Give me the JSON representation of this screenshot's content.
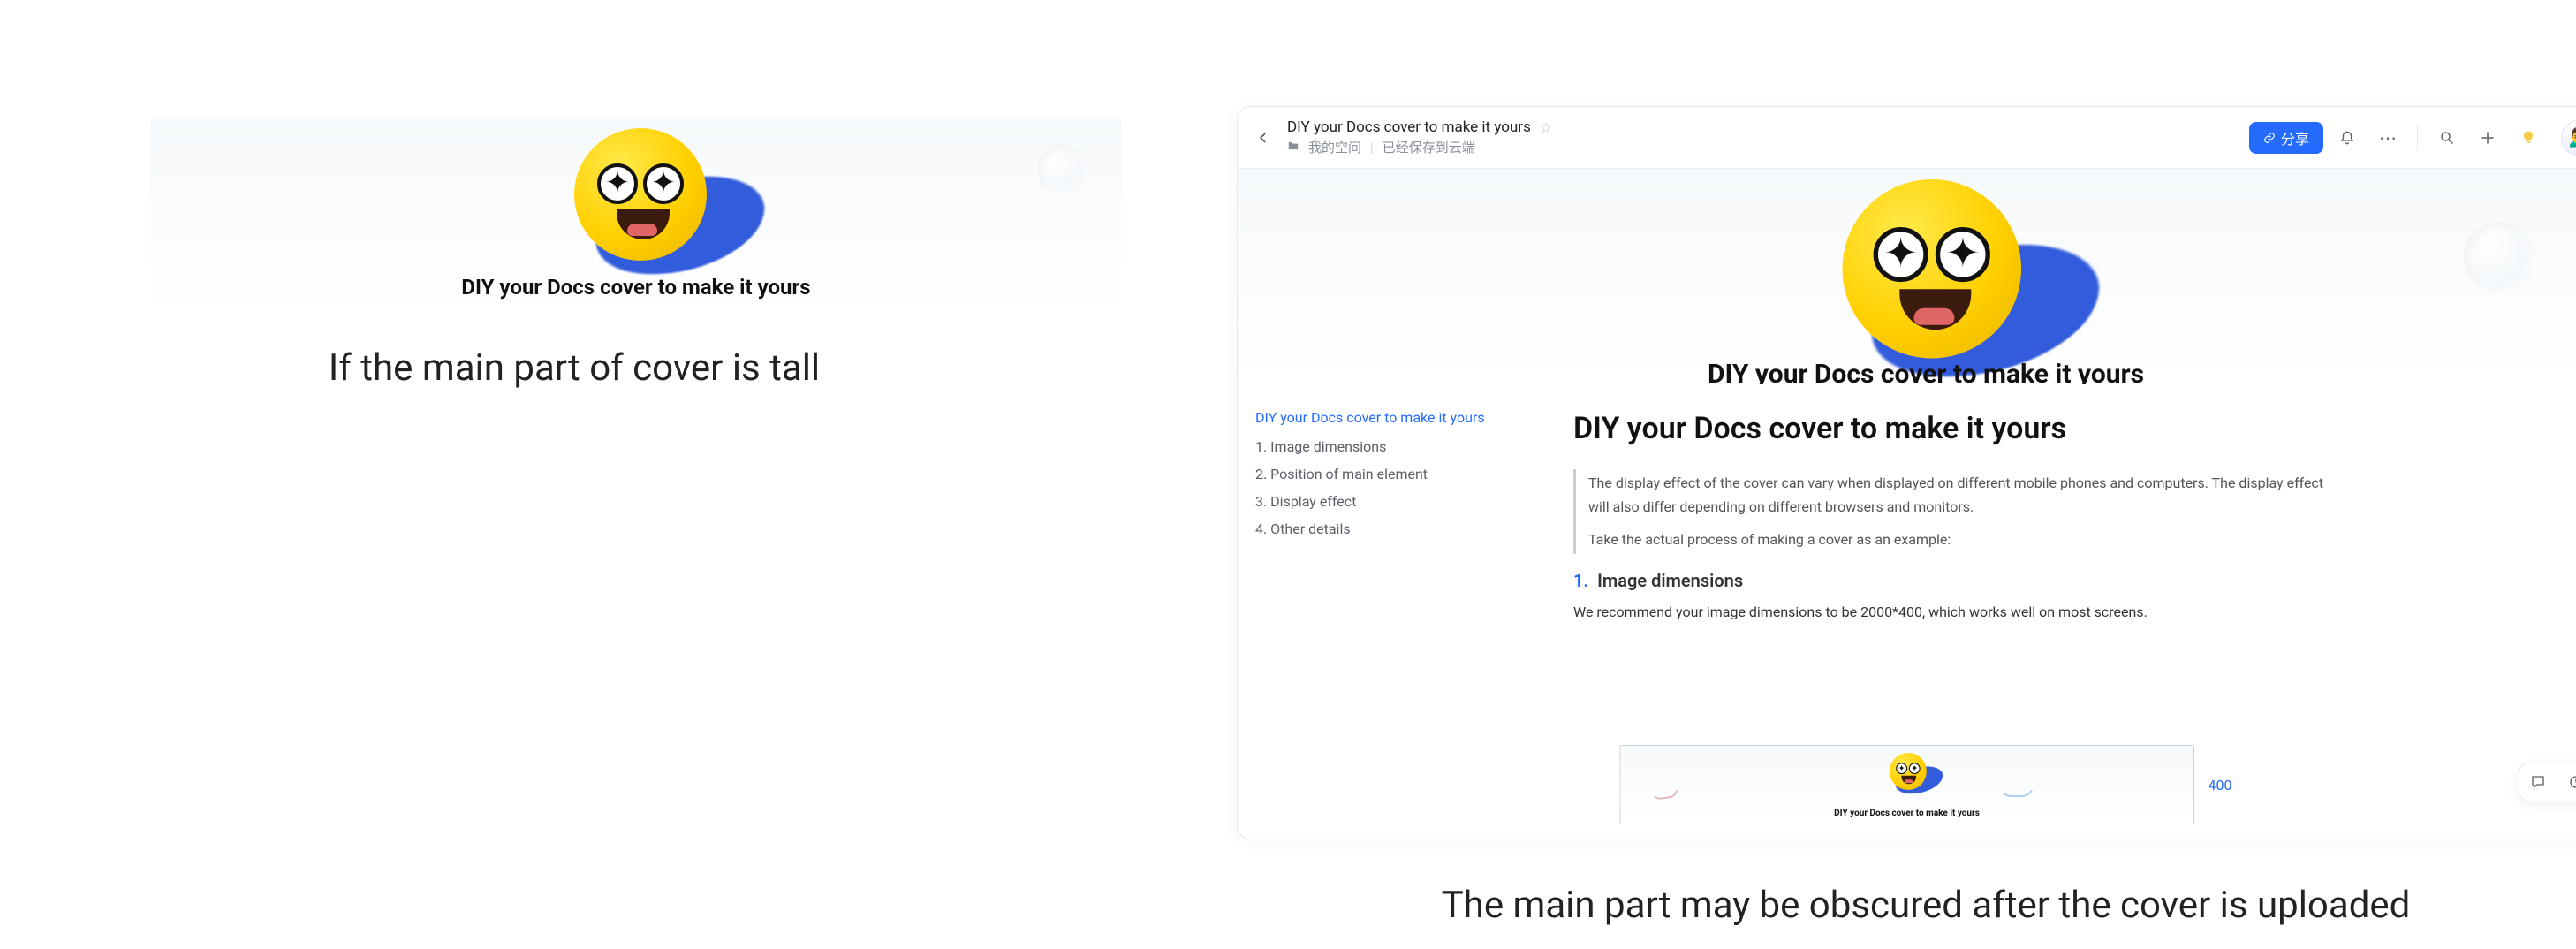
{
  "left": {
    "cover_title": "DIY your Docs cover to make it yours",
    "caption": "If the main part of cover is tall"
  },
  "right": {
    "caption": "The main part may be obscured after the cover is uploaded",
    "header": {
      "doc_title": "DIY your Docs cover to make it yours",
      "breadcrumb_space": "我的空间",
      "save_status": "已经保存到云端",
      "share_label": "分享"
    },
    "cover_title_cut": "DIY your Docs cover to make it yours",
    "outline": {
      "title": "DIY your Docs cover to make it yours",
      "items": [
        "1. Image dimensions",
        "2. Position of main element",
        "3. Display effect",
        "4. Other details"
      ]
    },
    "doc": {
      "h1": "DIY your Docs cover to make it yours",
      "quote_line1": "The display effect of the cover can vary when displayed on different mobile phones and computers. The display effect will also differ depending on different browsers and monitors.",
      "quote_line2": "Take the actual process of making a cover as an example:",
      "sec1_num": "1.",
      "sec1_title": "Image dimensions",
      "sec1_body": "We recommend your image dimensions to be 2000*400, which works well on most screens.",
      "mini_cover_text": "DIY your Docs cover to make it yours",
      "mini_dim": "400"
    }
  }
}
